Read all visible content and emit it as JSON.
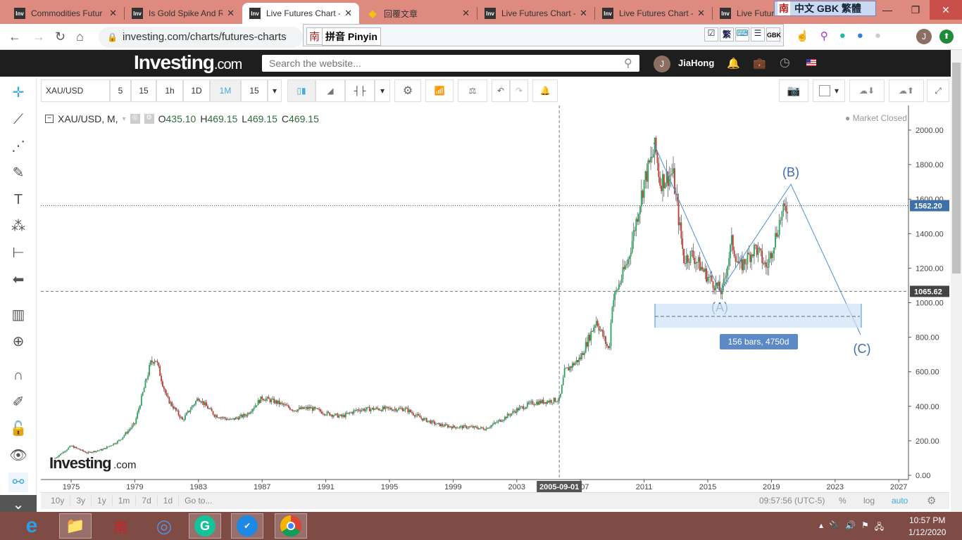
{
  "browser": {
    "tabs": [
      {
        "title": "Commodities Futur",
        "active": false
      },
      {
        "title": "Is Gold Spike And R",
        "active": false
      },
      {
        "title": "Live Futures Chart -",
        "active": true
      },
      {
        "title": "回覆文章",
        "active": false
      },
      {
        "title": "Live Futures Chart -",
        "active": false
      },
      {
        "title": "Live Futures Chart -",
        "active": false
      },
      {
        "title": "Live Futur",
        "active": false
      }
    ],
    "url": "investing.com/charts/futures-charts",
    "ime_bar": "中文 GBK 繁體",
    "ime_mode": "拼音 Pinyin",
    "ime_icons": [
      "繁",
      "GBK"
    ],
    "profile_initial": "J"
  },
  "site": {
    "logo": "Investing",
    "logo_suffix": ".com",
    "search_placeholder": "Search the website...",
    "user": "JiaHong",
    "user_initial": "J"
  },
  "toolbar": {
    "symbol": "XAU/USD",
    "intervals": [
      "5",
      "15",
      "1h",
      "1D",
      "1M",
      "15"
    ],
    "active_interval": "1M"
  },
  "legend": {
    "title": "XAU/USD, M,",
    "open_label": "O",
    "open": "435.10",
    "high_label": "H",
    "high": "469.15",
    "low_label": "L",
    "low": "469.15",
    "close_label": "C",
    "close": "469.15",
    "market_status": "Market Closed"
  },
  "chart_data": {
    "type": "candlestick",
    "title": "XAU/USD, M",
    "x_ticks": [
      "1975",
      "1979",
      "1983",
      "1987",
      "1991",
      "1995",
      "1999",
      "2003",
      "2007",
      "2011",
      "2015",
      "2019",
      "2023",
      "2027"
    ],
    "y_ticks": [
      "0.00",
      "200.00",
      "400.00",
      "600.00",
      "800.00",
      "1000.00",
      "1200.00",
      "1400.00",
      "1600.00",
      "1800.00",
      "2000.00"
    ],
    "ylim": [
      0,
      2000
    ],
    "xlim": [
      1973.8,
      2029
    ],
    "series": {
      "name": "XAU/USD monthly",
      "x": [
        1974,
        1975,
        1976,
        1977,
        1978,
        1979,
        1980,
        1980.3,
        1981,
        1982,
        1983,
        1984,
        1985,
        1986,
        1987,
        1988,
        1989,
        1990,
        1991,
        1992,
        1993,
        1994,
        1995,
        1996,
        1997,
        1998,
        1999,
        2000,
        2001,
        2002,
        2003,
        2004,
        2005,
        2005.7,
        2006,
        2007,
        2008,
        2008.8,
        2009,
        2010,
        2011,
        2011.7,
        2012,
        2012.8,
        2013.5,
        2014,
        2015,
        2015.9,
        2016.5,
        2017,
        2018,
        2018.7,
        2019,
        2019.6,
        2020
      ],
      "values": [
        100,
        170,
        130,
        150,
        200,
        300,
        650,
        680,
        450,
        320,
        450,
        350,
        320,
        350,
        450,
        420,
        380,
        390,
        360,
        340,
        380,
        385,
        385,
        385,
        330,
        295,
        280,
        280,
        270,
        320,
        380,
        420,
        430,
        440,
        600,
        680,
        900,
        720,
        1000,
        1250,
        1700,
        1900,
        1700,
        1750,
        1250,
        1280,
        1150,
        1060,
        1350,
        1200,
        1320,
        1200,
        1300,
        1500,
        1562
      ]
    },
    "current_price": "1562.20",
    "crosshair_price": "1065.62",
    "crosshair_date": "2005-09-01",
    "annotations": {
      "wave_labels": [
        "(A)",
        "(B)",
        "(C)"
      ],
      "range_label": "156 bars, 4750d"
    },
    "watermark": "Investing.com"
  },
  "bottombar": {
    "ranges": [
      "10y",
      "3y",
      "1y",
      "1m",
      "7d",
      "1d",
      "Go to..."
    ],
    "clock": "09:57:56 (UTC-5)",
    "options": [
      "%",
      "log",
      "auto"
    ]
  },
  "taskbar": {
    "time": "10:57 PM",
    "date": "1/12/2020"
  },
  "colors": {
    "up": "#26a65b",
    "down": "#c0392b",
    "accent": "#3fa9e0",
    "drawing": "#4a90d9"
  }
}
